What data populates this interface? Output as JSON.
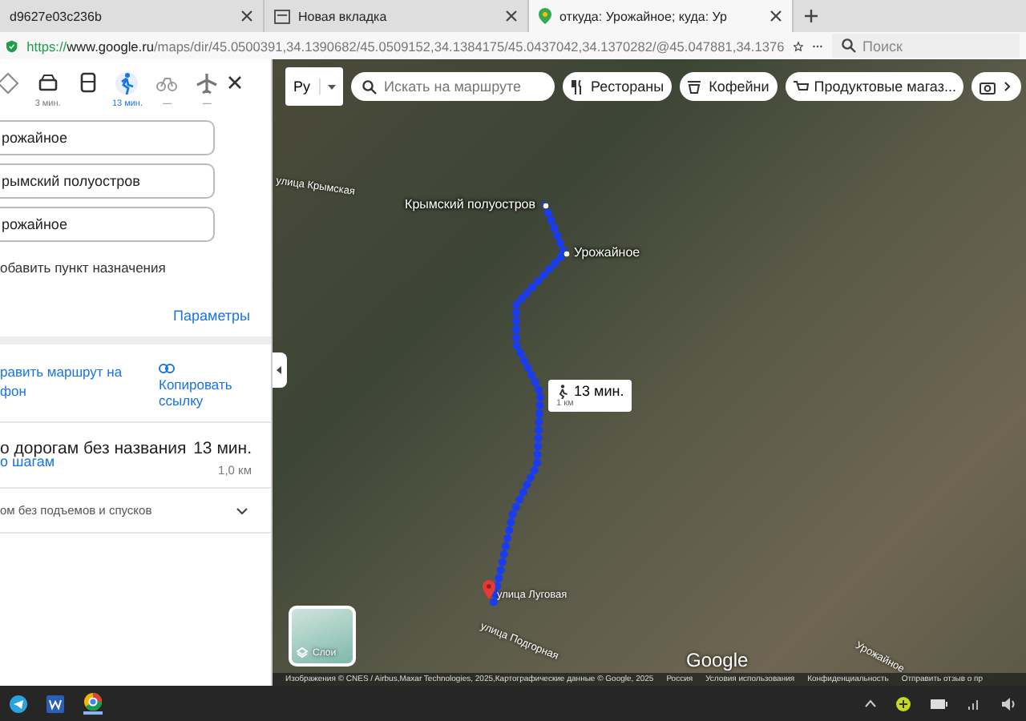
{
  "browser": {
    "tabs": [
      {
        "title": "d9627e03c236b",
        "selected": false
      },
      {
        "title": "Новая вкладка",
        "selected": false
      },
      {
        "title": "откуда: Урожайное; куда: Ур",
        "selected": true
      }
    ],
    "url_scheme": "https://",
    "url_host": "www.google.ru",
    "url_path": "/maps/dir/45.0500391,34.1390682/45.0509152,34.1384175/45.0437042,34.1370282/@45.047881,34.1376",
    "search_placeholder": "Поиск"
  },
  "panel": {
    "modes": [
      {
        "kind": "best",
        "selected": false
      },
      {
        "kind": "car",
        "time": "3 мин.",
        "selected": false
      },
      {
        "kind": "bus",
        "selected": false
      },
      {
        "kind": "walk",
        "time": "13 мин.",
        "selected": true
      },
      {
        "kind": "bike",
        "time": "—",
        "selected": false
      },
      {
        "kind": "plane",
        "time": "—",
        "selected": false
      }
    ],
    "stops": [
      "рожайное",
      "рымский полуостров",
      "рожайное"
    ],
    "add_stop": "обавить пункт назначения",
    "options": "Параметры",
    "send_line1": "равить маршрут на",
    "send_line2": "фон",
    "copy_link": "Копировать ссылку",
    "route": {
      "via": "о дорогам без названия",
      "time": "13 мин.",
      "distance": "1,0 км",
      "steps": "о шагам"
    },
    "alt_route": "ом без подъемов и спусков"
  },
  "map": {
    "language": "Ру",
    "search_placeholder": "Искать на маршруте",
    "chips": [
      {
        "kind": "food",
        "label": "Рестораны"
      },
      {
        "kind": "coffee",
        "label": "Кофейни"
      },
      {
        "kind": "cart",
        "label": "Продуктовые магаз..."
      },
      {
        "kind": "camera"
      }
    ],
    "places": [
      "Крымский полуостров",
      "Урожайное"
    ],
    "streets": [
      "улица Крымская",
      "улица Луговая",
      "улица Подгорная",
      "Урожайное"
    ],
    "bubble": {
      "time": "13 мин.",
      "distance": "1 км"
    },
    "layers": "Слои",
    "logo": "Google",
    "footer": [
      "Изображения © CNES / Airbus,Maxar Technologies, 2025,Картографические данные © Google, 2025",
      "Россия",
      "Условия использования",
      "Конфиденциальность",
      "Отправить отзыв о пр"
    ]
  }
}
